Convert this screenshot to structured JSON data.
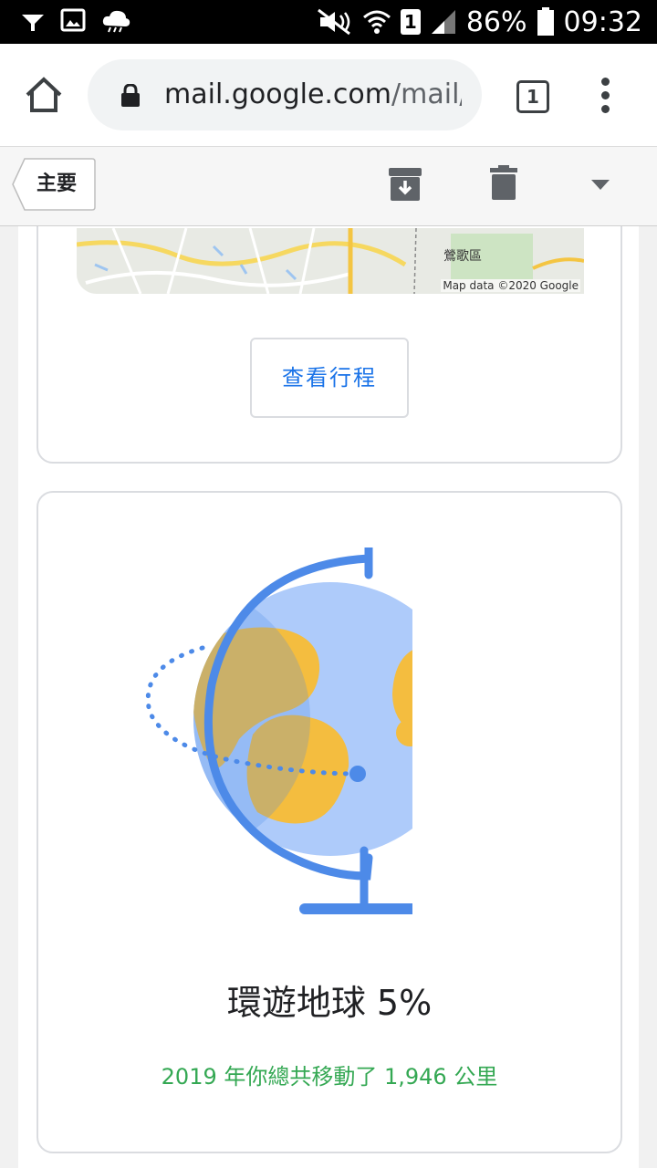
{
  "status_bar": {
    "battery_percent": "86%",
    "time": "09:32",
    "sim_slot": "1",
    "icons": [
      "signal-filter-icon",
      "image-icon",
      "cloud-icon",
      "mute-icon",
      "wifi-icon",
      "sim-icon",
      "cell-signal-icon",
      "battery-icon"
    ]
  },
  "browser": {
    "url_host": "mail.google.com",
    "url_path": "/mail/u",
    "tab_count": "1"
  },
  "gmail_toolbar": {
    "label": "主要"
  },
  "trip_card": {
    "map_place": "鶯歌區",
    "map_credit": "Map data ©2020 Google",
    "view_trip_label": "查看行程"
  },
  "globe_card": {
    "title": "環遊地球 5%",
    "subtitle": "2019 年你總共移動了 1,946 公里"
  },
  "colors": {
    "accent_blue": "#1a73e8",
    "globe_blue": "#aecbfa",
    "globe_yellow": "#f4bd3f",
    "stand_blue": "#4d8ae8",
    "subtitle_green": "#34a853"
  }
}
